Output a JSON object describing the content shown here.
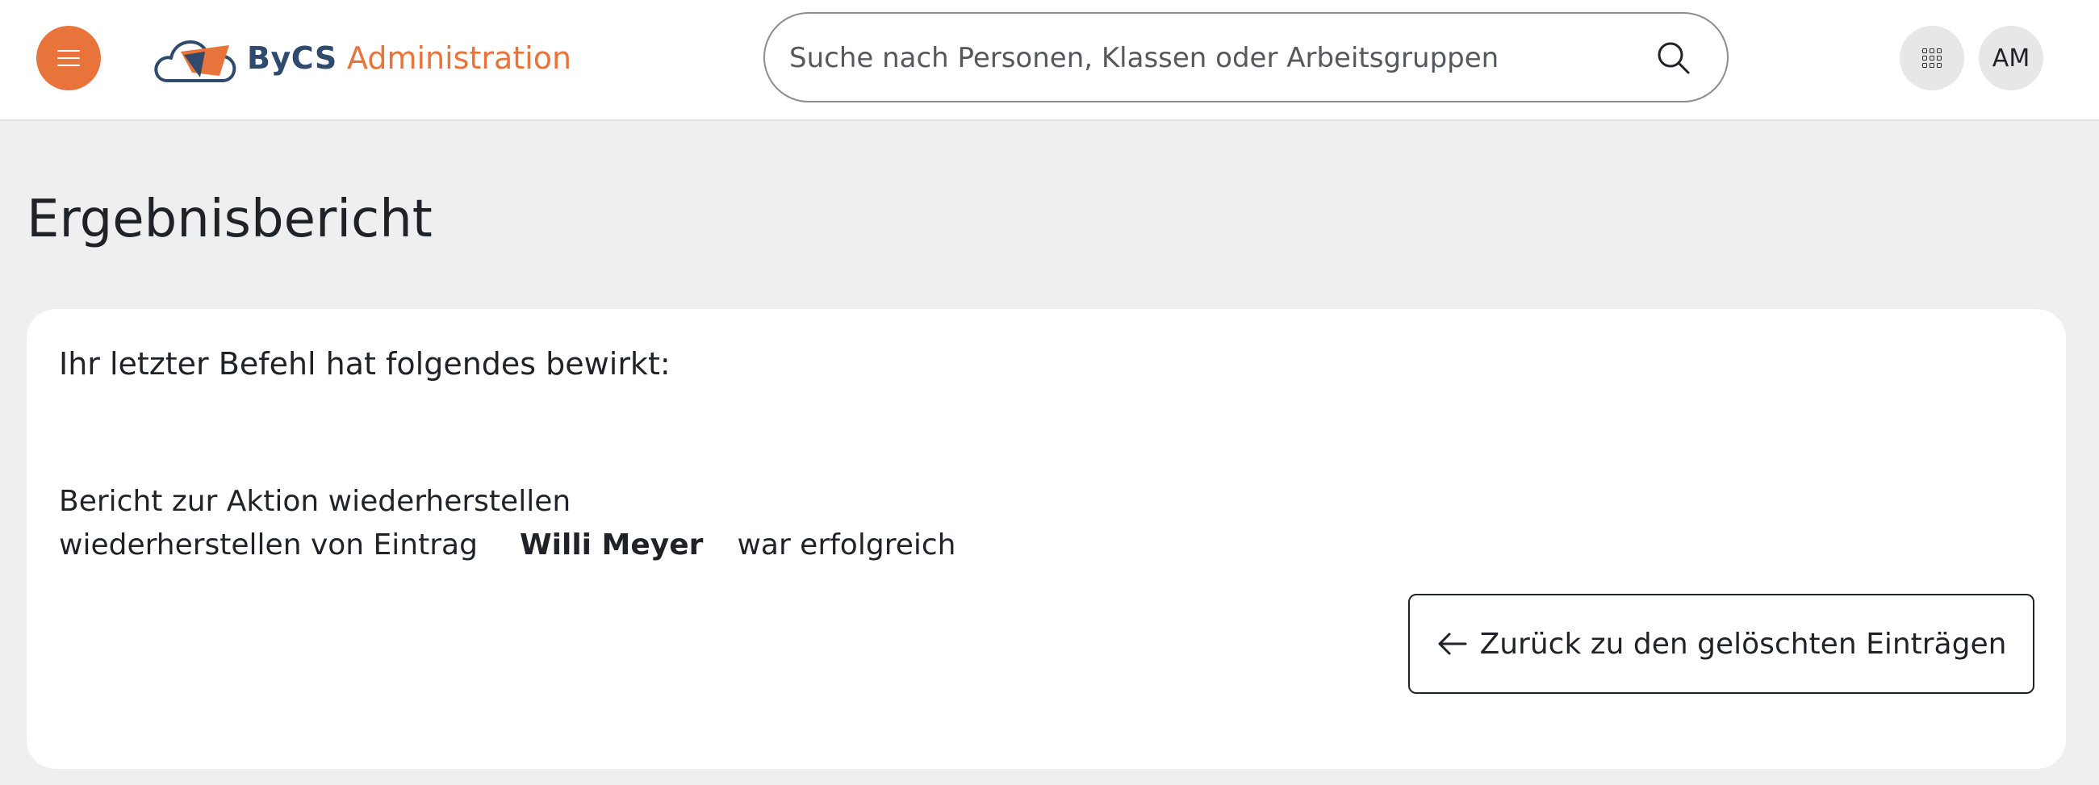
{
  "header": {
    "menu_icon": "hamburger-menu-icon",
    "brand": "ByCS",
    "app_title": "Administration",
    "search": {
      "placeholder": "Suche nach Personen, Klassen oder Arbeitsgruppen",
      "value": "",
      "icon": "search-icon"
    },
    "apps_icon": "grid-apps-icon",
    "avatar_initials": "AM",
    "colors": {
      "accent": "#e8743b",
      "brand_dark": "#2f4a6d"
    }
  },
  "page": {
    "title": "Ergebnisbericht"
  },
  "card": {
    "heading": "Ihr letzter Befehl hat folgendes bewirkt:",
    "report_title": "Bericht zur Aktion wiederherstellen",
    "report_prefix": "wiederherstellen von Eintrag",
    "entry_name": "Willi Meyer",
    "report_suffix": "war erfolgreich",
    "back_button": {
      "label": "Zurück zu den gelöschten Einträgen",
      "icon": "arrow-left-icon"
    }
  }
}
